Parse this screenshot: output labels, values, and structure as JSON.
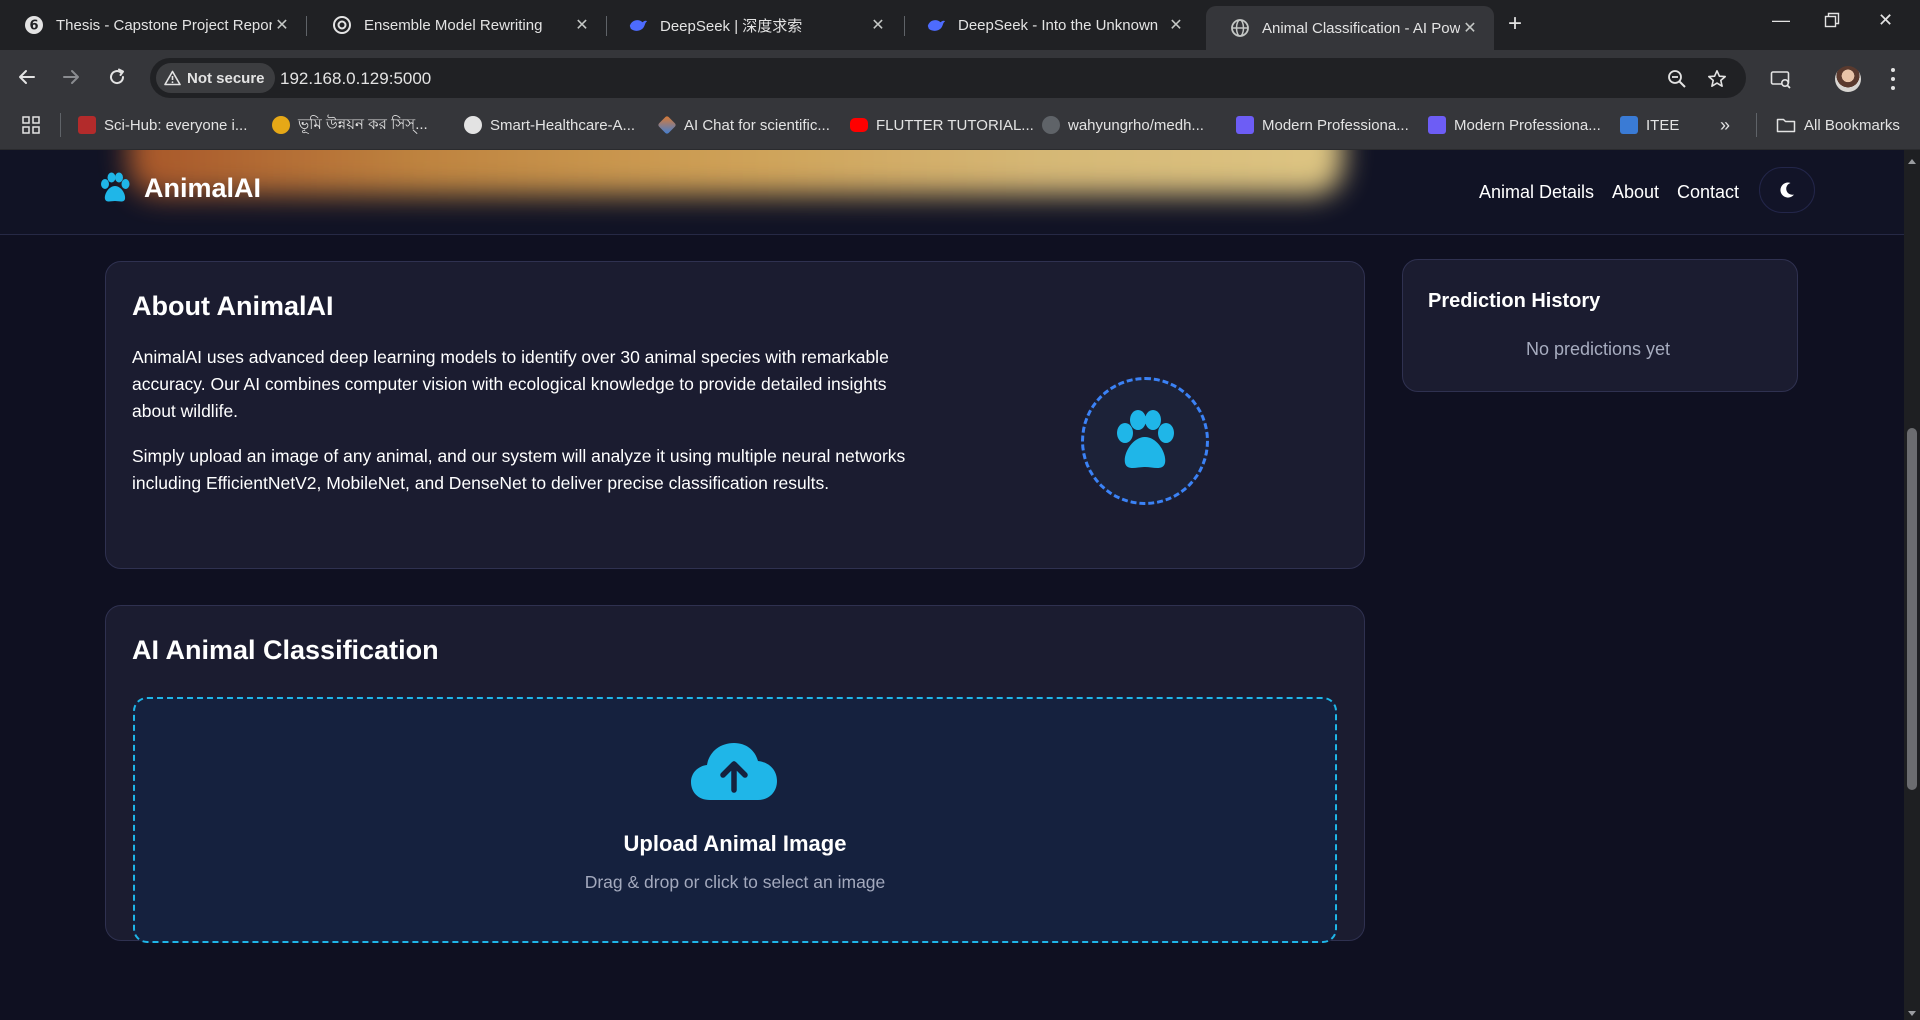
{
  "browser": {
    "tabs": [
      {
        "title": "Thesis - Capstone Project Repor",
        "icon": "thesis-icon"
      },
      {
        "title": "Ensemble Model Rewriting",
        "icon": "chatgpt-icon"
      },
      {
        "title": "DeepSeek | 深度求索",
        "icon": "deepseek-icon"
      },
      {
        "title": "DeepSeek - Into the Unknown",
        "icon": "deepseek-icon"
      },
      {
        "title": "Animal Classification - AI Power",
        "icon": "globe-icon",
        "active": true
      }
    ],
    "security_label": "Not secure",
    "url": "192.168.0.129:5000",
    "bookmarks": [
      {
        "label": "Sci-Hub: everyone i...",
        "color": "#b32b2b"
      },
      {
        "label": "ভূমি উন্নয়ন কর সিস্...",
        "color": "#e6a817"
      },
      {
        "label": "Smart-Healthcare-A...",
        "color": "#e3e3e3"
      },
      {
        "label": "AI Chat for scientific...",
        "color": "#e07a2e"
      },
      {
        "label": "FLUTTER TUTORIAL...",
        "color": "#ff0000"
      },
      {
        "label": "wahyungrho/medh...",
        "color": "#e3e3e3"
      },
      {
        "label": "Modern Professiona...",
        "color": "#6d5df5"
      },
      {
        "label": "Modern Professiona...",
        "color": "#6d5df5"
      },
      {
        "label": "ITEE",
        "color": "#3a7bd5"
      }
    ],
    "all_bookmarks_label": "All Bookmarks"
  },
  "navbar": {
    "brand": "AnimalAI",
    "links": [
      "Animal Details",
      "About",
      "Contact"
    ]
  },
  "about": {
    "title": "About AnimalAI",
    "p1": "AnimalAI uses advanced deep learning models to identify over 30 animal species with remarkable accuracy. Our AI combines computer vision with ecological knowledge to provide detailed insights about wildlife.",
    "p2": "Simply upload an image of any animal, and our system will analyze it using multiple neural networks including EfficientNetV2, MobileNet, and DenseNet to deliver precise classification results."
  },
  "history": {
    "title": "Prediction History",
    "empty": "No predictions yet"
  },
  "classify": {
    "title": "AI Animal Classification",
    "upload_title": "Upload Animal Image",
    "upload_sub": "Drag & drop or click to select an image"
  },
  "colors": {
    "accent": "#1fb6e8",
    "page_bg": "#0f1021",
    "card_bg": "#1b1c30"
  }
}
